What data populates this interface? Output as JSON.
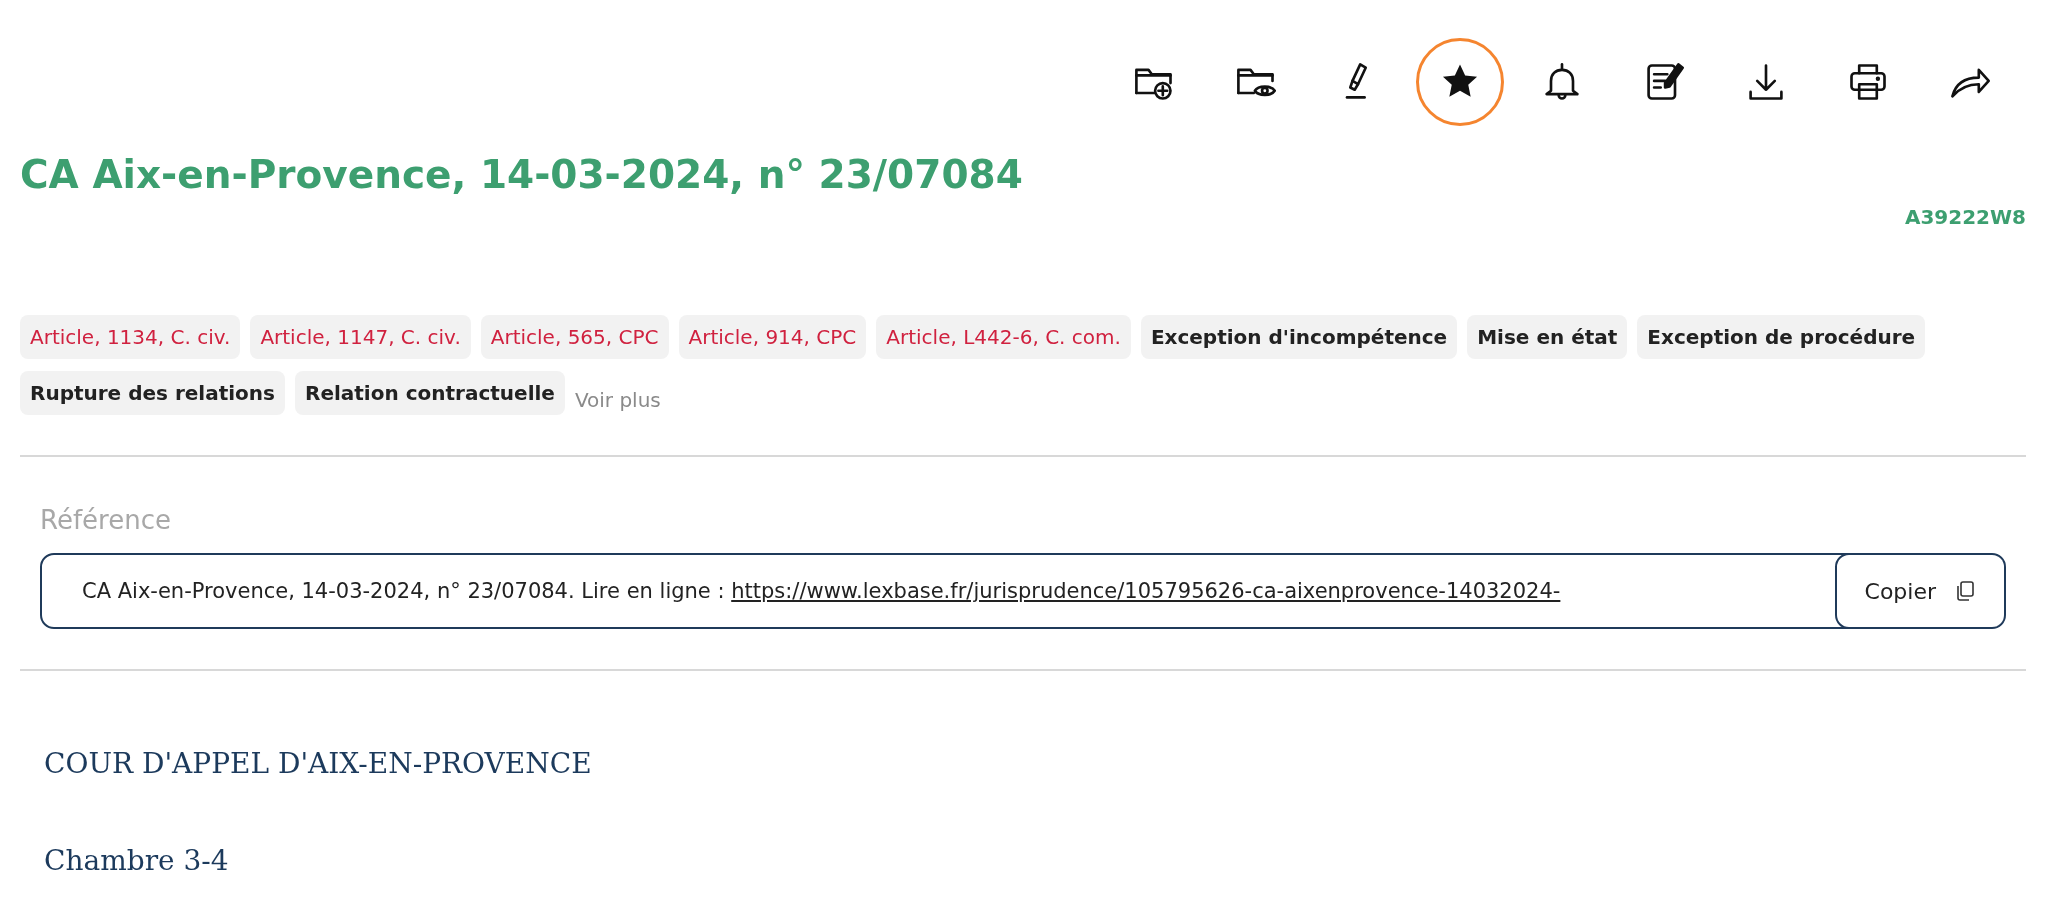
{
  "toolbar": [
    {
      "kind": "folder-add",
      "highlighted": false
    },
    {
      "kind": "folder-view",
      "highlighted": false
    },
    {
      "kind": "highlighter",
      "highlighted": false
    },
    {
      "kind": "star",
      "highlighted": true
    },
    {
      "kind": "bell",
      "highlighted": false
    },
    {
      "kind": "note",
      "highlighted": false
    },
    {
      "kind": "download",
      "highlighted": false
    },
    {
      "kind": "print",
      "highlighted": false
    },
    {
      "kind": "share",
      "highlighted": false
    }
  ],
  "title": "CA Aix-en-Provence, 14-03-2024, n° 23/07084",
  "document_id": "A39222W8",
  "tags": [
    {
      "label": "Article, 1134, C. civ.",
      "kind": "article"
    },
    {
      "label": "Article, 1147, C. civ.",
      "kind": "article"
    },
    {
      "label": "Article, 565, CPC",
      "kind": "article"
    },
    {
      "label": "Article, 914, CPC",
      "kind": "article"
    },
    {
      "label": "Article, L442-6, C. com.",
      "kind": "article"
    },
    {
      "label": "Exception d'incompétence",
      "kind": "keyword"
    },
    {
      "label": "Mise en état",
      "kind": "keyword"
    },
    {
      "label": "Exception de procédure",
      "kind": "keyword"
    },
    {
      "label": "Rupture des relations",
      "kind": "keyword"
    },
    {
      "label": "Relation contractuelle",
      "kind": "keyword"
    }
  ],
  "more_link": "Voir plus",
  "reference": {
    "label": "Référence",
    "text": "CA Aix-en-Provence, 14-03-2024, n° 23/07084. Lire en ligne : ",
    "url": "https://www.lexbase.fr/jurisprudence/105795626-ca-aixenprovence-14032024-",
    "copy_button": "Copier"
  },
  "body": [
    "COUR D'APPEL D'AIX-EN-PROVENCE",
    "Chambre 3-4"
  ]
}
